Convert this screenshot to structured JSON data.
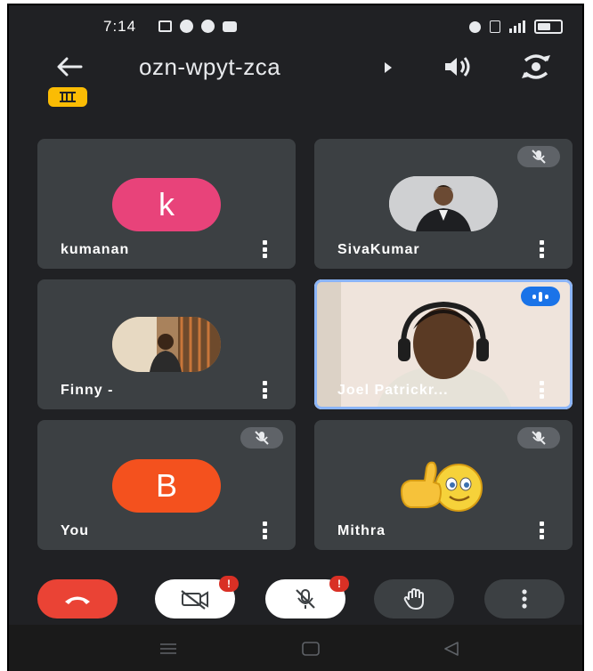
{
  "status_bar": {
    "time": "7:14"
  },
  "header": {
    "meeting_code": "ozn-wpyt-zca"
  },
  "participants": [
    {
      "name": "kumanan",
      "initial": "k",
      "avatar_color": "#e8437a",
      "muted": false
    },
    {
      "name": "SivaKumar",
      "muted": true
    },
    {
      "name": "Finny -",
      "muted": false
    },
    {
      "name": "Joel Patrickr...",
      "muted": false,
      "speaking": true
    },
    {
      "name": "You",
      "initial": "B",
      "avatar_color": "#f4511e",
      "muted": true
    },
    {
      "name": "Mithra",
      "muted": true
    }
  ],
  "controls": {
    "camera_alert": "!",
    "mic_alert": "!"
  },
  "colors": {
    "background": "#202124",
    "tile": "#3c4043",
    "end_call": "#ea4335",
    "speaking": "#8ab4f8"
  }
}
